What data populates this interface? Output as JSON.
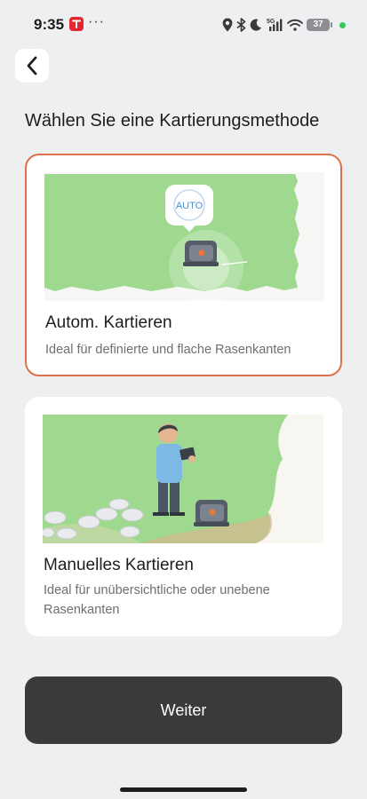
{
  "status_bar": {
    "time": "9:35",
    "dots": "···",
    "battery": "37",
    "network": "5G",
    "icons": [
      "location-icon",
      "bluetooth-icon",
      "moon-icon",
      "signal-icon",
      "wifi-icon",
      "battery-icon"
    ]
  },
  "header": {
    "back_icon": "chevron-left-icon",
    "title": "Wählen Sie eine Kartierungsmethode"
  },
  "options": [
    {
      "title": "Autom. Kartieren",
      "description": "Ideal für definierte und flache Rasenkanten",
      "badge": "AUTO",
      "selected": true
    },
    {
      "title": "Manuelles Kartieren",
      "description": "Ideal für unübersichtliche oder unebene Rasenkanten",
      "selected": false
    }
  ],
  "footer": {
    "continue_label": "Weiter"
  },
  "colors": {
    "accent": "#e0704a",
    "button": "#3a3a3c",
    "background": "#eeeff1",
    "grass": "#9fd98f"
  }
}
